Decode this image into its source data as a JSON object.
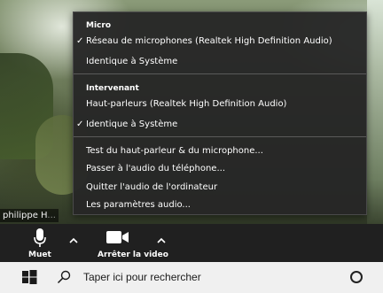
{
  "video": {
    "participant_name": "philippe H",
    "participant_name_faded": "..."
  },
  "audio_menu": {
    "sections": {
      "microphone": {
        "header": "Micro",
        "items": [
          {
            "label": "Réseau de microphones (Realtek High Definition Audio)",
            "checked": true
          },
          {
            "label": "Identique à Système",
            "checked": false
          }
        ]
      },
      "speaker": {
        "header": "Intervenant",
        "items": [
          {
            "label": "Haut-parleurs (Realtek High Definition Audio)",
            "checked": false
          },
          {
            "label": "Identique à Système",
            "checked": true
          }
        ]
      }
    },
    "actions": [
      "Test du haut-parleur & du microphone...",
      "Passer à l'audio du téléphone...",
      "Quitter l'audio de l'ordinateur",
      "Les paramètres audio..."
    ],
    "check_mark": "✓"
  },
  "toolbar": {
    "mute_label": "Muet",
    "video_label": "Arrêter la video",
    "mute_icon": "microphone-icon",
    "video_icon": "video-camera-icon"
  },
  "taskbar": {
    "search_placeholder": "Taper ici pour rechercher",
    "start_icon": "windows-logo-icon",
    "task_view_icon": "cortana-circle-icon"
  },
  "colors": {
    "menu_bg": "#262626",
    "toolbar_bg": "#202020",
    "taskbar_bg": "#f0f0f0",
    "text_light": "#ffffff"
  }
}
